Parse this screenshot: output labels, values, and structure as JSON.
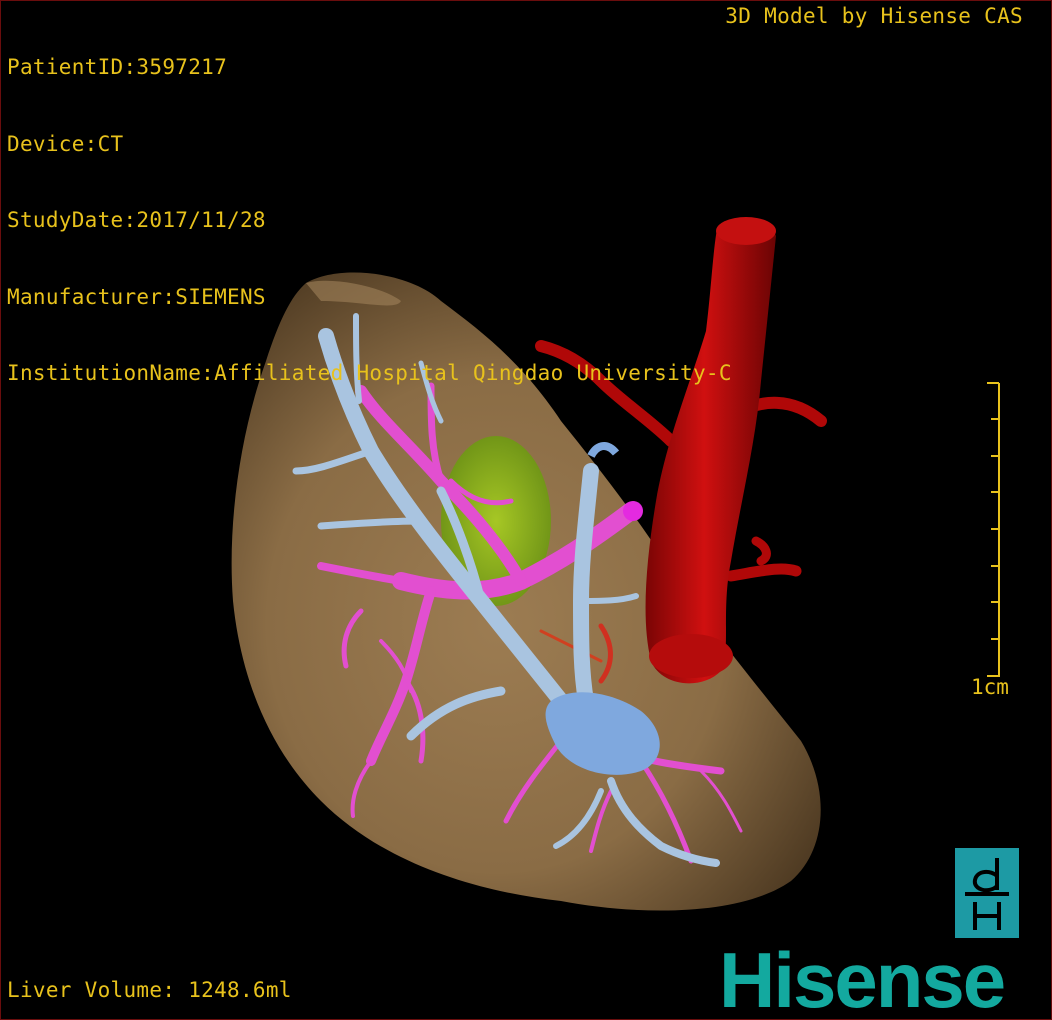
{
  "overlay": {
    "patient_id": "PatientID:3597217",
    "device": "Device:CT",
    "study_date": "StudyDate:2017/11/28",
    "manufacturer": "Manufacturer:SIEMENS",
    "institution": "InstitutionName:Affiliated Hospital Qingdao University-C",
    "model_credit": "3D Model by Hisense CAS",
    "liver_volume": "Liver Volume: 1248.6ml"
  },
  "scale": {
    "label": "1cm"
  },
  "branding": {
    "logo_mark": "dH",
    "logo_text": "Hisense"
  },
  "colors": {
    "liver": "#8a6d45",
    "portal_vein": "#a9c4e0",
    "hepatic_vein": "#e24fd0",
    "artery": "#c80a0a",
    "lesion": "#9ac21a",
    "text": "#e8c21c",
    "brand": "#13a99f"
  }
}
